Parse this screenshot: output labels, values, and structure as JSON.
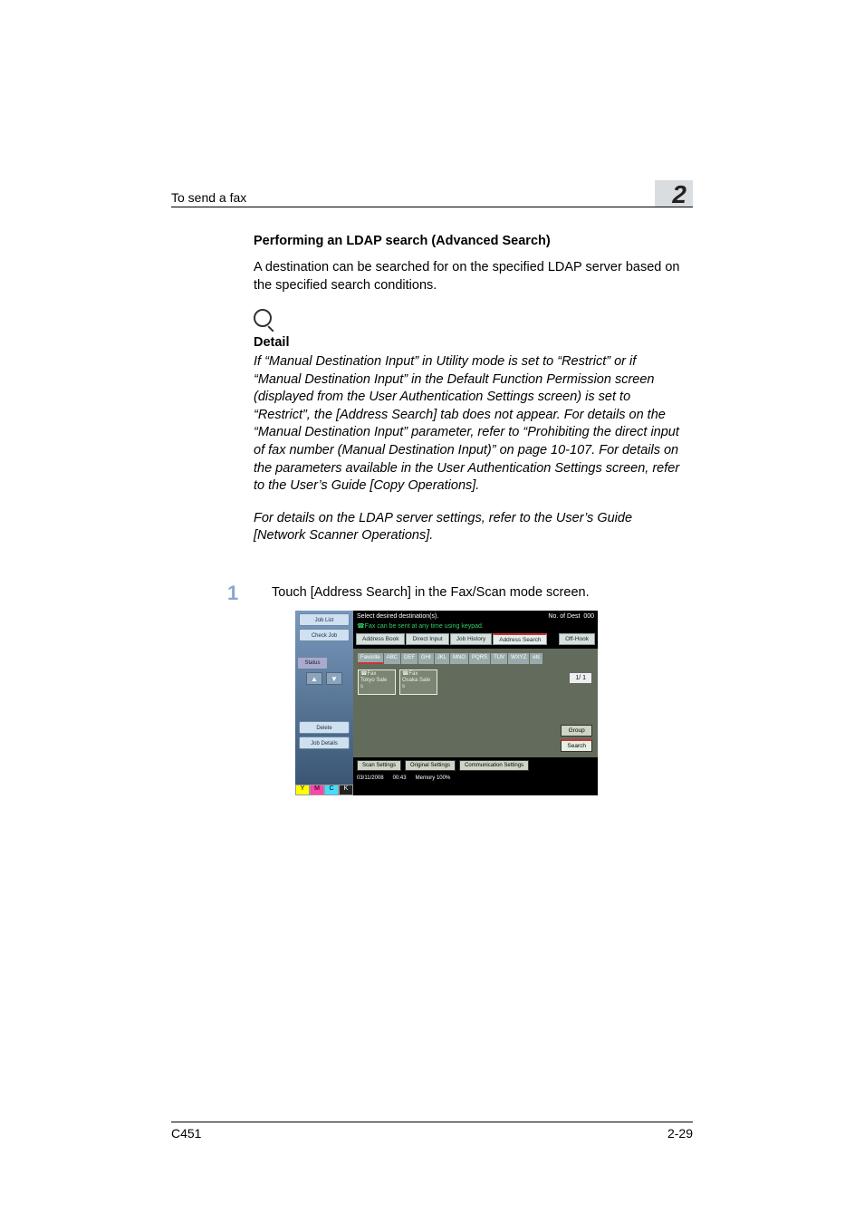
{
  "header": {
    "section_title": "To send a fax",
    "chapter_number": "2"
  },
  "content": {
    "subtitle": "Performing an LDAP search (Advanced Search)",
    "intro": "A destination can be searched for on the specified LDAP server based on the specified search conditions.",
    "detail": {
      "label": "Detail",
      "para1": "If “Manual Destination Input” in Utility mode is set to “Restrict” or if “Manual Destination Input” in the Default Function Permission screen (displayed from the User Authentication Settings screen) is set to “Restrict”, the [Address Search] tab does not appear. For details on the “Manual Destination Input” parameter, refer to “Prohibiting the direct input of fax number (Manual Destination Input)” on page 10-107. For details on the parameters available in the User Authentication Settings screen, refer to the User’s Guide [Copy Operations].",
      "para2": "For details on the LDAP server settings, refer to the User’s Guide [Network Scanner Operations]."
    }
  },
  "step": {
    "number": "1",
    "text": "Touch [Address Search] in the Fax/Scan mode screen."
  },
  "screenshot": {
    "left": {
      "job_list": "Job List",
      "check_job": "Check Job",
      "status": "Status",
      "delete": "Delete",
      "job_details": "Job Details"
    },
    "header": {
      "title": "Select desired destination(s).",
      "badge": "No. of Dest",
      "count": "000",
      "hint": "☎Fax can be sent at any time using keypad."
    },
    "tabs": {
      "address_book": "Address Book",
      "direct_input": "Direct Input",
      "job_history": "Job History",
      "address_search": "Address Search",
      "off_hook": "Off-Hook"
    },
    "alpha": {
      "first": "Favorite",
      "items": [
        "ABC",
        "DEF",
        "GHI",
        "JKL",
        "MNO",
        "PQRS",
        "TUV",
        "WXYZ",
        "etc"
      ]
    },
    "dest": {
      "d1_l1": "☎Fax",
      "d1_l2": "Tokyo Sale",
      "d1_l3": "s",
      "d2_l1": "☎Fax",
      "d2_l2": "Osaka Sale",
      "d2_l3": "s"
    },
    "page_indicator": "1/  1",
    "side": {
      "group": "Group",
      "search": "Search"
    },
    "bottom": {
      "scan_settings": "Scan Settings",
      "original_settings": "Original Settings",
      "comm_settings": "Communication Settings"
    },
    "meta": {
      "date": "03/11/2008",
      "time": "00:43",
      "memory_label": "Memory",
      "memory_percent": "100%"
    },
    "toner": {
      "y": "Y",
      "m": "M",
      "c": "C",
      "k": "K"
    }
  },
  "footer": {
    "model": "C451",
    "page_no": "2-29"
  }
}
